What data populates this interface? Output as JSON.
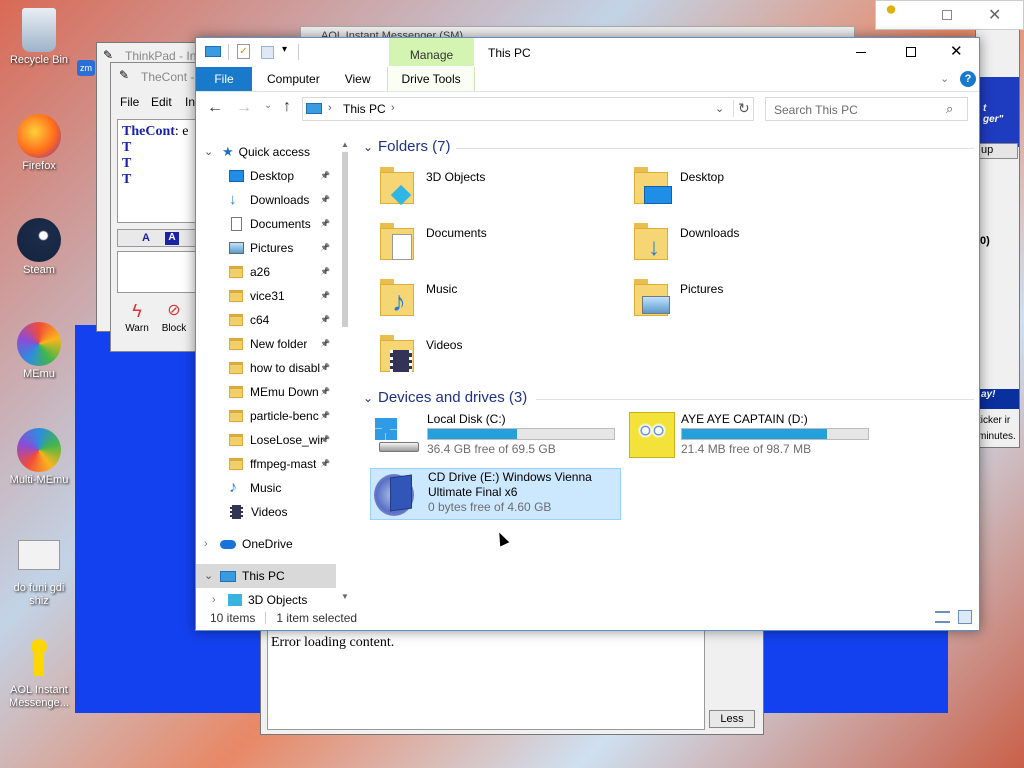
{
  "desktop": {
    "icons": [
      {
        "label": "Recycle Bin"
      },
      {
        "label": "Firefox"
      },
      {
        "label": "Steam"
      },
      {
        "label": "MEmu"
      },
      {
        "label": "Multi-MEmu"
      },
      {
        "label": "do funi gdi shiz"
      },
      {
        "label": "AOL Instant Messenge..."
      }
    ]
  },
  "background_windows": {
    "thinkpad_title": "ThinkPad - In",
    "thecont_title": "TheCont -",
    "thecont_menu": [
      "File",
      "Edit",
      "In"
    ],
    "thecont_text": "TheCont",
    "thecont_text_tail": ": e",
    "thecont_t": "T",
    "warn_label": "Warn",
    "block_label": "Block",
    "aol_title": "AOL Instant Messenger (SM)",
    "aol_side": [
      "t",
      "ger\"",
      "up",
      "0)",
      "ay!",
      "ticker ir",
      "minutes."
    ],
    "error_text": "Error loading content.",
    "less_label": "Less"
  },
  "explorer": {
    "title": "This PC",
    "manage_tab": "Manage",
    "ribbon_tabs": {
      "file": "File",
      "computer": "Computer",
      "view": "View",
      "drive_tools": "Drive Tools"
    },
    "address": "This PC",
    "search_placeholder": "Search This PC",
    "nav": {
      "quick_access": "Quick access",
      "items": [
        {
          "label": "Desktop",
          "icon": "desktop"
        },
        {
          "label": "Downloads",
          "icon": "download"
        },
        {
          "label": "Documents",
          "icon": "documents"
        },
        {
          "label": "Pictures",
          "icon": "pictures"
        },
        {
          "label": "a26",
          "icon": "folder"
        },
        {
          "label": "vice31",
          "icon": "folder"
        },
        {
          "label": "c64",
          "icon": "folder"
        },
        {
          "label": "New folder",
          "icon": "folder"
        },
        {
          "label": "how to disabl",
          "icon": "folder"
        },
        {
          "label": "MEmu Down",
          "icon": "folder"
        },
        {
          "label": "particle-benc",
          "icon": "folder"
        },
        {
          "label": "LoseLose_wir",
          "icon": "folder"
        },
        {
          "label": "ffmpeg-mast",
          "icon": "folder"
        },
        {
          "label": "Music",
          "icon": "music"
        },
        {
          "label": "Videos",
          "icon": "videos"
        }
      ],
      "onedrive": "OneDrive",
      "this_pc": "This PC",
      "sub_3d": "3D Objects"
    },
    "folders_header": "Folders (7)",
    "folders": [
      "3D Objects",
      "Desktop",
      "Documents",
      "Downloads",
      "Music",
      "Pictures",
      "Videos"
    ],
    "devices_header": "Devices and drives (3)",
    "drives": [
      {
        "name": "Local Disk (C:)",
        "free": "36.4 GB free of 69.5 GB",
        "used": 0.48
      },
      {
        "name": "AYE AYE CAPTAIN (D:)",
        "free": "21.4 MB free of 98.7 MB",
        "used": 0.78
      },
      {
        "name": "CD Drive (E:) Windows Vienna Ultimate Final x6",
        "free": "0 bytes free of 4.60 GB"
      }
    ],
    "status_items": "10 items",
    "status_selected": "1 item selected"
  },
  "colors": {
    "accent": "#0078d7",
    "selected": "#cce8ff",
    "bar": "#26a0da"
  }
}
